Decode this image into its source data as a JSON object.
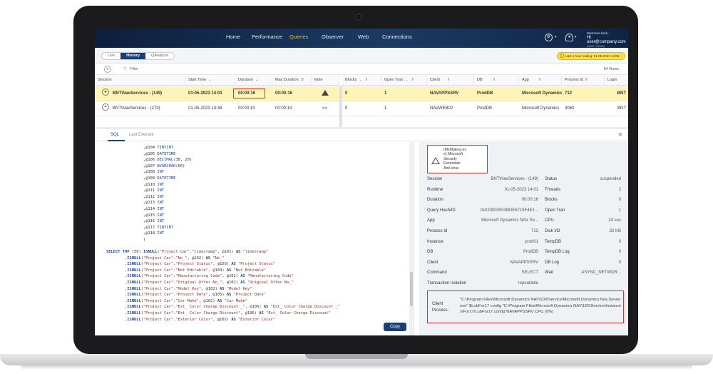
{
  "nav": {
    "items": [
      "Home",
      "Performance",
      "Queries",
      "Observer",
      "Web",
      "Connections"
    ],
    "active": "Queries",
    "user": {
      "welcome": "Welcome back,",
      "email": "Hi user@company.com",
      "tz": "(GMT +02:00)"
    }
  },
  "controls": {
    "modes": [
      "Live",
      "History",
      "QAnalyze"
    ],
    "active_mode": "History",
    "time_range": "Last 1 hour ending: 01-05-2023 14:05"
  },
  "filter": {
    "label": "Filter",
    "rows": "54 Rows"
  },
  "grid": {
    "left_headers": [
      "Session",
      "Start Time",
      "Duration",
      "Max Duration",
      "Note"
    ],
    "right_headers": [
      "Blocks",
      "Open Tran",
      "Client",
      "DB",
      "App",
      "Process Id",
      "Login"
    ],
    "rows": [
      {
        "session": "BNT\\NavServices - (149)",
        "start": "01-05-2023 14:01",
        "duration": "00:00:16",
        "max": "00:00:16",
        "blocks": "0",
        "open_tran": "1",
        "client": "NAVAPPSSRV",
        "db": "ProdDB",
        "app": "Microsoft Dynamics",
        "pid": "712",
        "login": "BNT"
      },
      {
        "session": "BNT\\NavServices - (270)",
        "start": "01-05-2023 13:48",
        "duration": "00:00:14",
        "max": "00:00:14",
        "blocks": "0",
        "open_tran": "1",
        "client": "NAVWEB02",
        "db": "ProdDB",
        "app": "Microsoft Dynamics",
        "pid": "3060",
        "login": "BNT"
      }
    ]
  },
  "tabs": {
    "sql": "SQL",
    "last_execute": "Last Execute"
  },
  "sql_lines": [
    "                ,@104 TINYINT",
    "                ,@105 DATETIME",
    "                ,@106 DECIMAL(38, 20)",
    "                ,@107 NVARCHAR(60)",
    "                ,@108 INT",
    "                ,@109 DATETIME",
    "                ,@110 INT",
    "                ,@111 INT",
    "                ,@112 INT",
    "                ,@113 INT",
    "                ,@114 INT",
    "                ,@115 INT",
    "                ,@116 INT",
    "                ,@117 TINYINT",
    "                ,@118 INT",
    "                )",
    "",
    "SELECT TOP (50) ISNULL(\"Project Car\".\"timestamp\", @101) AS \"timestamp\"",
    "        ,ISNULL(\"Project Car\".\"No_\", @102) AS \"No_\"",
    "        ,ISNULL(\"Project Car\".\"Project Status\", @103) AS \"Project Status\"",
    "        ,ISNULL(\"Project Car\".\"Not Editable\", @104) AS \"Not Editable\"",
    "        ,ISNULL(\"Project Car\".\"Manufacturing Code\", @102) AS \"Manufacturing Code\"",
    "        ,ISNULL(\"Project Car\".\"Original Offer No_\", @102) AS \"Original Offer No_\"",
    "        ,ISNULL(\"Project Car\".\"Model Key\", @102) AS \"Model Key\"",
    "        ,ISNULL(\"Project Car\".\"Project Date\", @105) AS \"Project Date\"",
    "        ,ISNULL(\"Project Car\".\"Car Make\", @102) AS \"Car Make\"",
    "        ,ISNULL(\"Project Car\".\"Ext_ Color Charge Discount _\", @106) AS \"Ext_ Color Charge Discount _\"",
    "        ,ISNULL(\"Project Car\".\"Ext_ Color Charge Discount\", @106) AS \"Ext_ Color Charge Discount\"",
    "        ,ISNULL(\"Project Car\".\"Exterior Color\", @102) AS \"Exterior Color\""
  ],
  "copy_label": "Copy",
  "tooltip": {
    "lines": [
      "(MsMpEng.ex",
      "e) Microsoft",
      "Security",
      "Essentials",
      "Anti-virus"
    ]
  },
  "details": {
    "left": [
      {
        "label": "Session",
        "value": "BNT\\NavServices - (149)"
      },
      {
        "label": "Runtime",
        "value": "01-05-2023 14:01"
      },
      {
        "label": "Duration",
        "value": "00:00:16"
      },
      {
        "label": "Query Hash/ID",
        "value": "0x020000003BDE6715F4E1..."
      },
      {
        "label": "App",
        "value": "Microsoft Dynamics NAV Se..."
      },
      {
        "label": "Process Id",
        "value": "712"
      },
      {
        "label": "Instance",
        "value": "prod01"
      },
      {
        "label": "DB",
        "value": "ProdDB"
      },
      {
        "label": "Client",
        "value": "NAVAPPSSRV"
      },
      {
        "label": "Command",
        "value": "SELECT"
      },
      {
        "label": "Transaction Isolation",
        "value": "repeatable"
      }
    ],
    "right": [
      {
        "label": "Status",
        "value": "suspended"
      },
      {
        "label": "Threads",
        "value": "2"
      },
      {
        "label": "Blocks",
        "value": "0"
      },
      {
        "label": "Open Tran",
        "value": "1"
      },
      {
        "label": "CPU",
        "value": "24 sec"
      },
      {
        "label": "Disk I/O",
        "value": "32 KB"
      },
      {
        "label": "TempDB",
        "value": "0"
      },
      {
        "label": "TempDB Log",
        "value": "0"
      },
      {
        "label": "DB Log",
        "value": "0"
      },
      {
        "label": "Wait",
        "value": "ASYNC_NETWOR..."
      }
    ],
    "process_label_1": "Client",
    "process_label_2": "Process:",
    "process_value": "\"C:\\Program Files\\Microsoft Dynamics NAV\\100\\Service\\Microsoft.Dynamics.Nav.Server.exe\" $LubFor17 config \"C:\\Program Files\\Microsoft Dynamics NAV\\100\\Service\\Instances\\For17\\LubFor17.config\"NAVAPPSSRV CPU (0%)"
  }
}
